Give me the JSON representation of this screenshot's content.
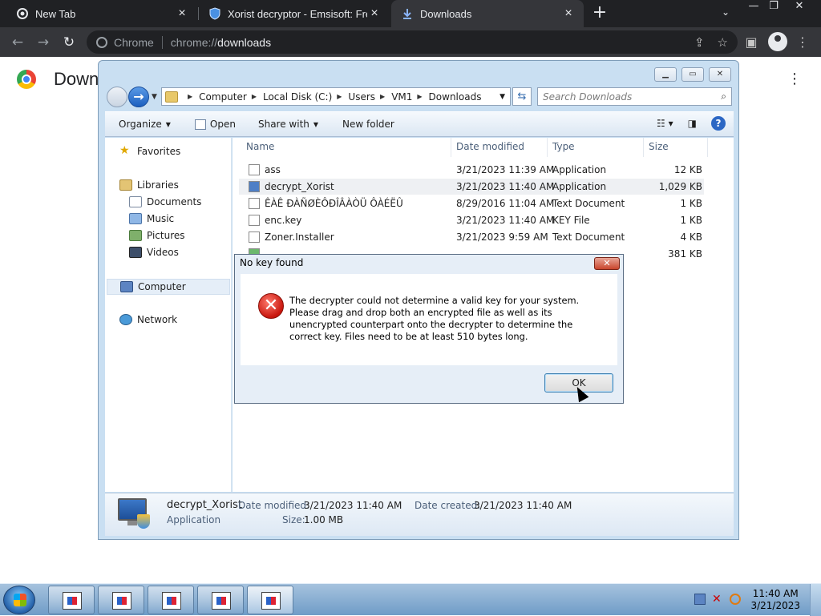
{
  "browser": {
    "tabs": [
      {
        "title": "New Tab",
        "active": false
      },
      {
        "title": "Xorist decryptor - Emsisoft: Free",
        "active": false
      },
      {
        "title": "Downloads",
        "active": true
      }
    ],
    "new_tab_label": "+",
    "omnibox": {
      "site_label": "Chrome",
      "url_scheme": "chrome://",
      "url_host": "downloads"
    },
    "page_title": "Down"
  },
  "explorer": {
    "breadcrumbs": [
      "Computer",
      "Local Disk (C:)",
      "Users",
      "VM1",
      "Downloads"
    ],
    "search_placeholder": "Search Downloads",
    "commands": {
      "organize": "Organize",
      "open": "Open",
      "share_with": "Share with",
      "new_folder": "New folder"
    },
    "nav": {
      "favorites": "Favorites",
      "libraries": "Libraries",
      "documents": "Documents",
      "music": "Music",
      "pictures": "Pictures",
      "videos": "Videos",
      "computer": "Computer",
      "network": "Network"
    },
    "columns": {
      "name": "Name",
      "date": "Date modified",
      "type": "Type",
      "size": "Size"
    },
    "files": [
      {
        "name": "ass",
        "date": "3/21/2023 11:39 AM",
        "type": "Application",
        "size": "12 KB"
      },
      {
        "name": "decrypt_Xorist",
        "date": "3/21/2023 11:40 AM",
        "type": "Application",
        "size": "1,029 KB"
      },
      {
        "name": "ÊÀÊ ÐÀÑØÈÔÐÎÂÀÒÜ ÔÀÉËÛ",
        "date": "8/29/2016 11:04 AM",
        "type": "Text Document",
        "size": "1 KB"
      },
      {
        "name": "enc.key",
        "date": "3/21/2023 11:40 AM",
        "type": "KEY File",
        "size": "1 KB"
      },
      {
        "name": "Zoner.Installer",
        "date": "3/21/2023 9:59 AM",
        "type": "Text Document",
        "size": "4 KB"
      },
      {
        "name": "",
        "date": "",
        "type": "",
        "size": "381 KB"
      }
    ],
    "details": {
      "name": "decrypt_Xorist",
      "kind": "Application",
      "date_modified_label": "Date modified:",
      "date_modified": "3/21/2023 11:40 AM",
      "date_created_label": "Date created:",
      "date_created": "3/21/2023 11:40 AM",
      "size_label": "Size:",
      "size": "1.00 MB"
    }
  },
  "dialog": {
    "title": "No key found",
    "message": "The decrypter could not determine a valid key for your system. Please drag and drop both an encrypted file as well as its unencrypted counterpart onto the decrypter to determine the correct key. Files need to be at least 510 bytes long.",
    "ok_label": "OK"
  },
  "taskbar": {
    "time": "11:40 AM",
    "date": "3/21/2023"
  }
}
